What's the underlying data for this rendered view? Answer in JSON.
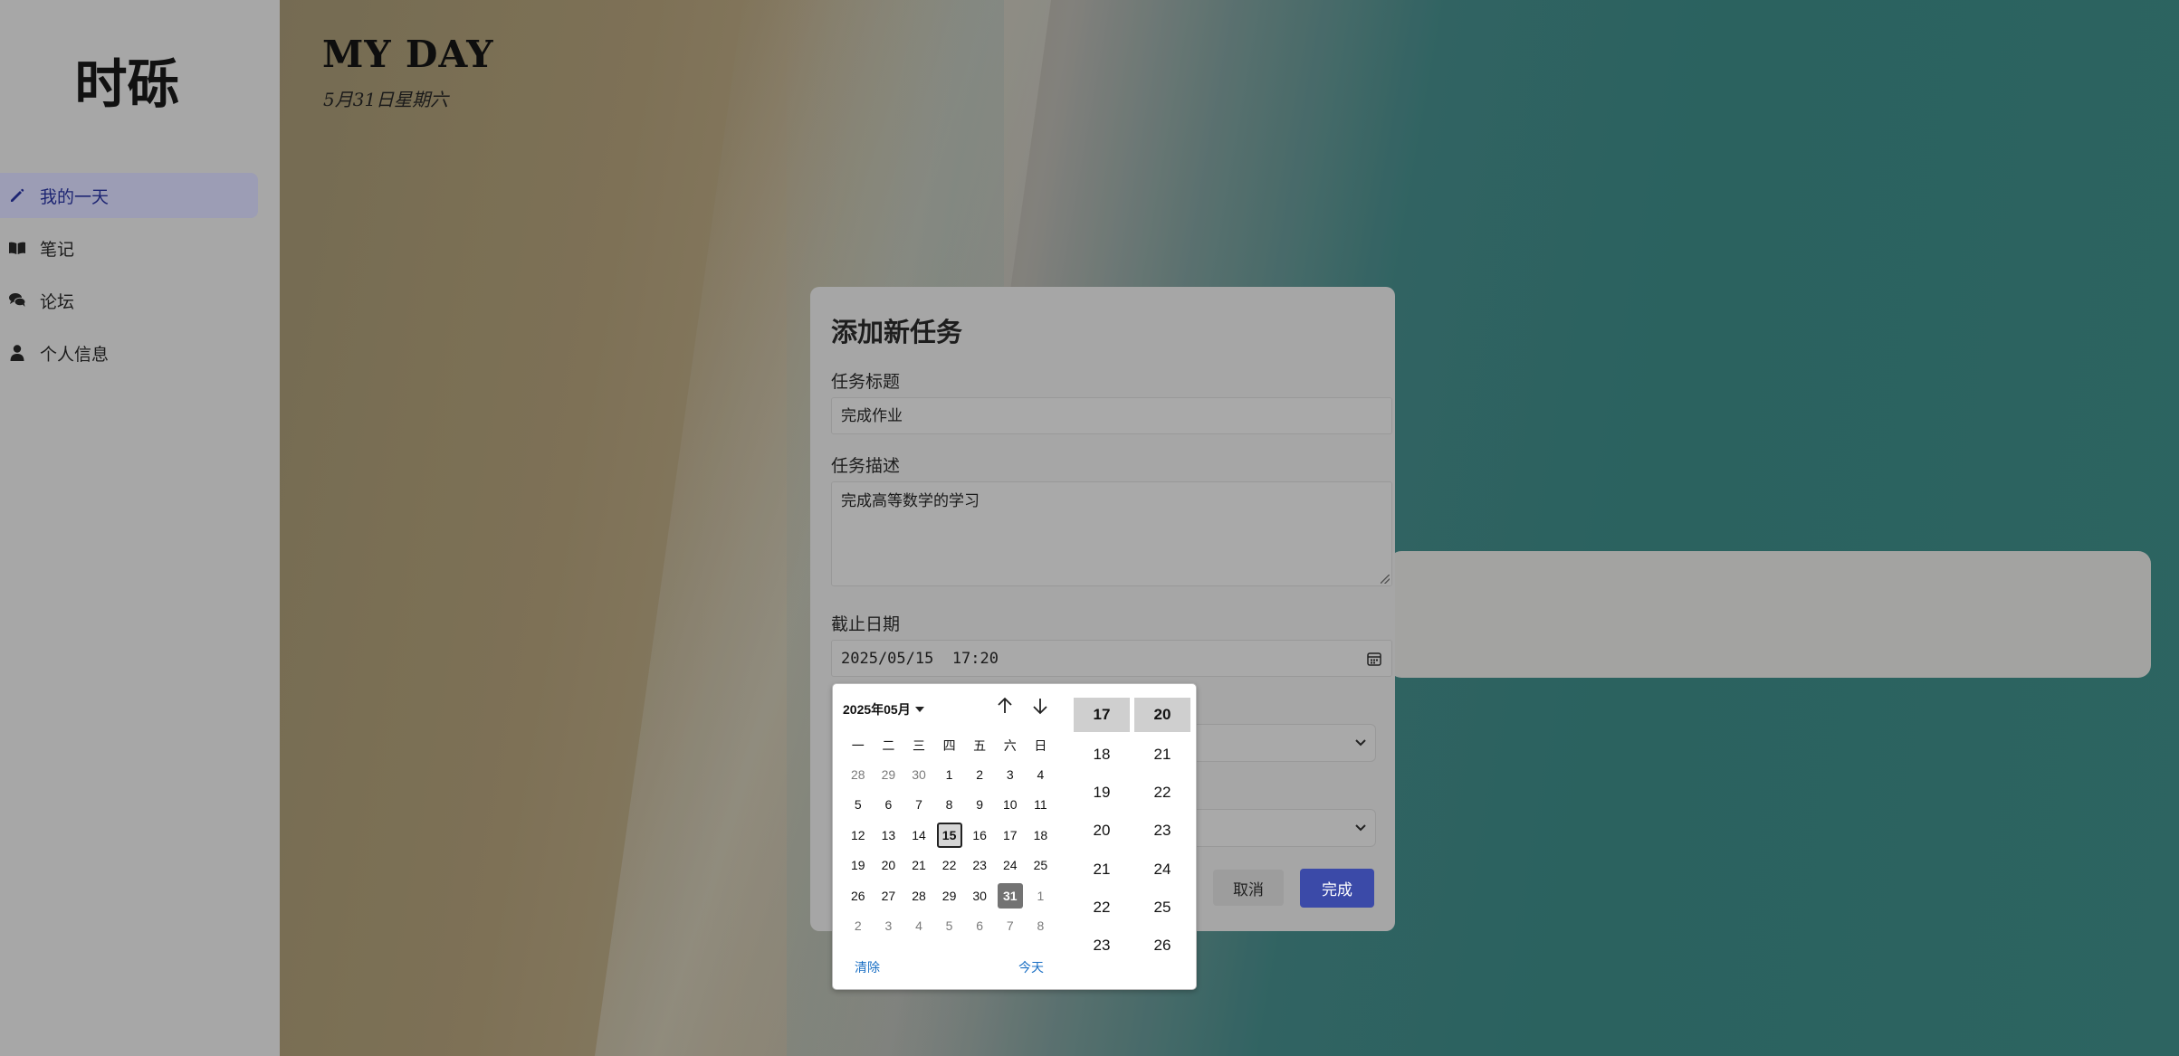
{
  "sidebar": {
    "logo": "时砾",
    "items": [
      {
        "label": "我的一天",
        "icon": "pencil-icon",
        "active": true
      },
      {
        "label": "笔记",
        "icon": "book-icon",
        "active": false
      },
      {
        "label": "论坛",
        "icon": "comments-icon",
        "active": false
      },
      {
        "label": "个人信息",
        "icon": "user-icon",
        "active": false
      }
    ]
  },
  "main": {
    "title": "MY DAY",
    "subtitle": "5月31日星期六"
  },
  "modal": {
    "title": "添加新任务",
    "task_title_label": "任务标题",
    "task_title_value": "完成作业",
    "task_desc_label": "任务描述",
    "task_desc_value": "完成高等数学的学习",
    "deadline_label": "截止日期",
    "deadline_value": "2025/05/15  17:20",
    "cancel_label": "取消",
    "done_label": "完成",
    "accent": "#3b4aa8"
  },
  "datepicker": {
    "month_label": "2025年05月",
    "weekdays": [
      "一",
      "二",
      "三",
      "四",
      "五",
      "六",
      "日"
    ],
    "weeks": [
      [
        "28",
        "29",
        "30",
        "1",
        "2",
        "3",
        "4"
      ],
      [
        "5",
        "6",
        "7",
        "8",
        "9",
        "10",
        "11"
      ],
      [
        "12",
        "13",
        "14",
        "15",
        "16",
        "17",
        "18"
      ],
      [
        "19",
        "20",
        "21",
        "22",
        "23",
        "24",
        "25"
      ],
      [
        "26",
        "27",
        "28",
        "29",
        "30",
        "31",
        "1"
      ],
      [
        "2",
        "3",
        "4",
        "5",
        "6",
        "7",
        "8"
      ]
    ],
    "selected_day": "15",
    "today_day": "31",
    "clear_label": "清除",
    "today_label": "今天",
    "hours": [
      "17",
      "18",
      "19",
      "20",
      "21",
      "22",
      "23"
    ],
    "minutes": [
      "20",
      "21",
      "22",
      "23",
      "24",
      "25",
      "26"
    ],
    "selected_hour": "17",
    "selected_minute": "20"
  }
}
